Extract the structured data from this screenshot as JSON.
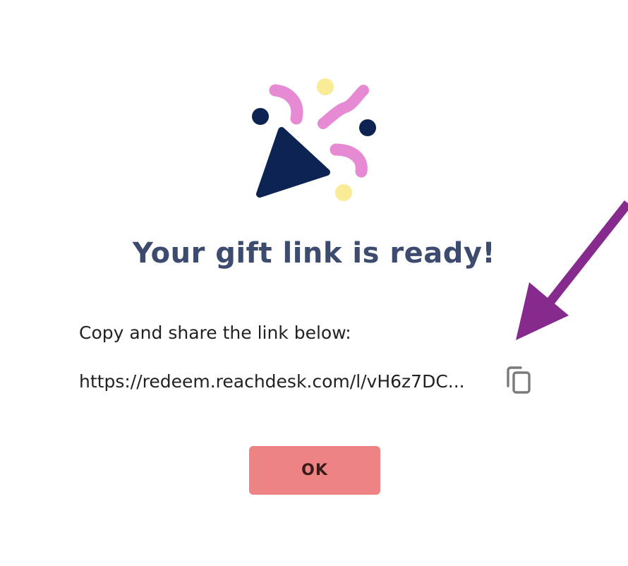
{
  "dialog": {
    "title": "Your gift link is ready!",
    "instruction": "Copy and share the link below:",
    "link_text": "https://redeem.reachdesk.com/l/vH6z7DC...",
    "ok_label": "OK"
  },
  "icons": {
    "illustration": "party-popper-icon",
    "copy": "copy-icon",
    "annotation": "arrow-icon"
  },
  "colors": {
    "title": "#3d4b6f",
    "button": "#ee8383",
    "popper_navy": "#0d2352",
    "confetti_pink": "#e58ad3",
    "confetti_yellow": "#faec96",
    "arrow": "#862a8e",
    "copy_icon": "#7a7a7a"
  }
}
